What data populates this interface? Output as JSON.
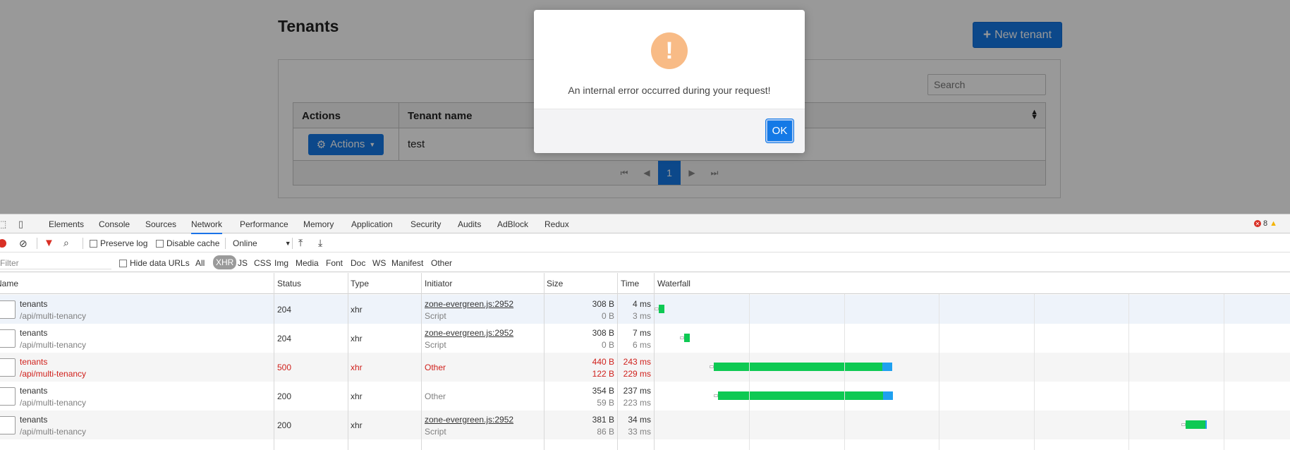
{
  "app": {
    "title": "Tenants",
    "new_tenant_label": "New tenant",
    "search_placeholder": "Search",
    "table": {
      "col_actions": "Actions",
      "col_name": "Tenant name",
      "rows": [
        {
          "actions_label": "Actions",
          "name": "test"
        }
      ]
    },
    "pagination": {
      "current_page": "1"
    }
  },
  "dialog": {
    "icon_glyph": "!",
    "message": "An internal error occurred during your request!",
    "ok_label": "OK"
  },
  "devtools": {
    "tabs": [
      "Elements",
      "Console",
      "Sources",
      "Network",
      "Performance",
      "Memory",
      "Application",
      "Security",
      "Audits",
      "AdBlock",
      "Redux"
    ],
    "active_tab": "Network",
    "error_count": "8",
    "toolbar": {
      "preserve_log": "Preserve log",
      "disable_cache": "Disable cache",
      "throttle": "Online"
    },
    "filter": {
      "placeholder": "Filter",
      "hide_data_urls": "Hide data URLs",
      "types": [
        "All",
        "XHR",
        "JS",
        "CSS",
        "Img",
        "Media",
        "Font",
        "Doc",
        "WS",
        "Manifest",
        "Other"
      ],
      "active_type": "XHR"
    },
    "columns": {
      "name": "Name",
      "status": "Status",
      "type": "Type",
      "initiator": "Initiator",
      "size": "Size",
      "time": "Time",
      "waterfall": "Waterfall"
    },
    "requests": [
      {
        "name": "tenants",
        "path": "/api/multi-tenancy",
        "status": "204",
        "type": "xhr",
        "initiator": "zone-evergreen.js:2952",
        "initiator_sub": "Script",
        "size": "308 B",
        "size_sub": "0 B",
        "time": "4 ms",
        "time_sub": "3 ms",
        "wf_start": 0.005,
        "wf_wait": 0.004,
        "wf_recv": 0.0
      },
      {
        "name": "tenants",
        "path": "/api/multi-tenancy",
        "status": "204",
        "type": "xhr",
        "initiator": "zone-evergreen.js:2952",
        "initiator_sub": "Script",
        "size": "308 B",
        "size_sub": "0 B",
        "time": "7 ms",
        "time_sub": "6 ms",
        "wf_start": 0.045,
        "wf_wait": 0.008,
        "wf_recv": 0.0
      },
      {
        "name": "tenants",
        "path": "/api/multi-tenancy",
        "status": "500",
        "type": "xhr",
        "initiator": "Other",
        "initiator_sub": "",
        "size": "440 B",
        "size_sub": "122 B",
        "time": "243 ms",
        "time_sub": "229 ms",
        "wf_start": 0.091,
        "wf_wait": 0.266,
        "wf_recv": 0.016
      },
      {
        "name": "tenants",
        "path": "/api/multi-tenancy",
        "status": "200",
        "type": "xhr",
        "initiator": "Other",
        "initiator_sub": "",
        "size": "354 B",
        "size_sub": "59 B",
        "time": "237 ms",
        "time_sub": "223 ms",
        "wf_start": 0.098,
        "wf_wait": 0.26,
        "wf_recv": 0.016
      },
      {
        "name": "tenants",
        "path": "/api/multi-tenancy",
        "status": "200",
        "type": "xhr",
        "initiator": "zone-evergreen.js:2952",
        "initiator_sub": "Script",
        "size": "381 B",
        "size_sub": "86 B",
        "time": "34 ms",
        "time_sub": "33 ms",
        "wf_start": 0.835,
        "wf_wait": 0.032,
        "wf_recv": 0.001
      }
    ]
  }
}
